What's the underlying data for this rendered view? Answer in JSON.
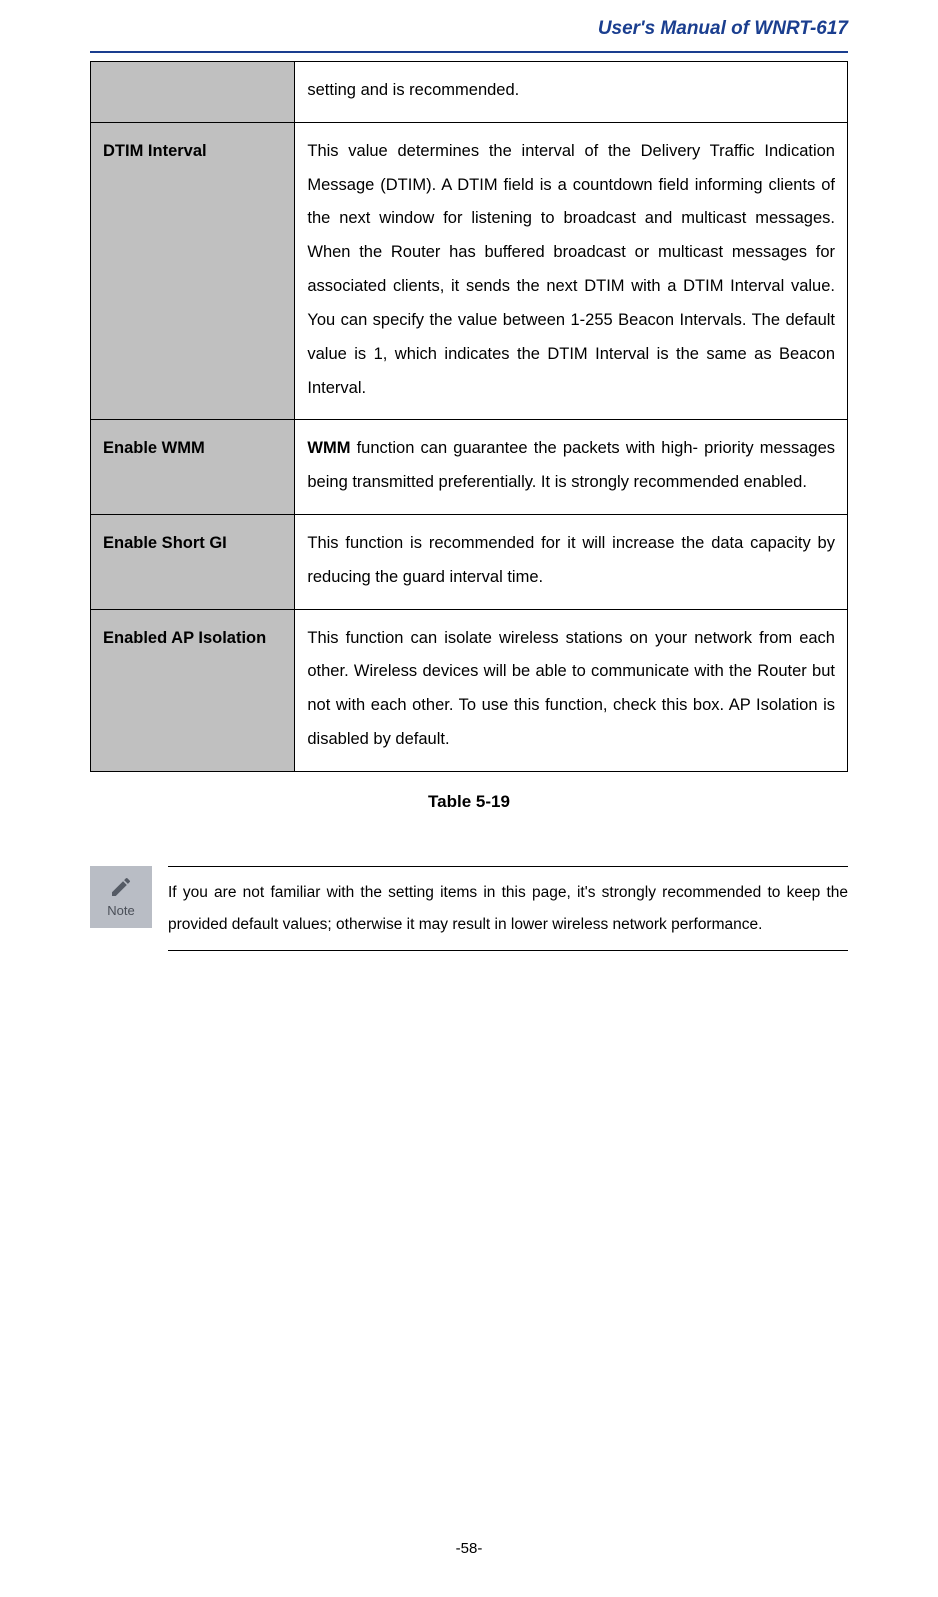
{
  "header": {
    "title": "User's Manual of WNRT-617"
  },
  "table": {
    "rows": [
      {
        "label": "",
        "desc": "setting and is recommended."
      },
      {
        "label": "DTIM Interval",
        "desc": "This value determines the interval of the Delivery Traffic Indication Message (DTIM). A DTIM field is a countdown field informing clients of the next window for listening to broadcast and multicast messages. When the Router has buffered broadcast or multicast messages for associated clients, it sends the next DTIM with a DTIM Interval value. You can specify the value between 1-255 Beacon Intervals. The default value is 1, which indicates the DTIM Interval is the same as Beacon Interval."
      },
      {
        "label": "Enable WMM",
        "desc_prefix_bold": "WMM",
        "desc_rest": " function can guarantee the packets with high- priority messages being transmitted preferentially. It is strongly recommended enabled."
      },
      {
        "label": "Enable Short GI",
        "desc": "This function is recommended for it will increase the data capacity by reducing the guard interval time."
      },
      {
        "label": "Enabled AP Isolation",
        "desc": "This function can isolate wireless stations on your network from each other. Wireless devices will be able to communicate with the Router but not with each other. To use this function, check this box. AP Isolation is disabled by default."
      }
    ],
    "caption": "Table 5-19"
  },
  "note": {
    "icon_label": "Note",
    "text": "If you are not familiar with the setting items in this page, it's strongly recommended to keep the provided default values; otherwise it may result in lower wireless network performance."
  },
  "page_number": "-58-"
}
